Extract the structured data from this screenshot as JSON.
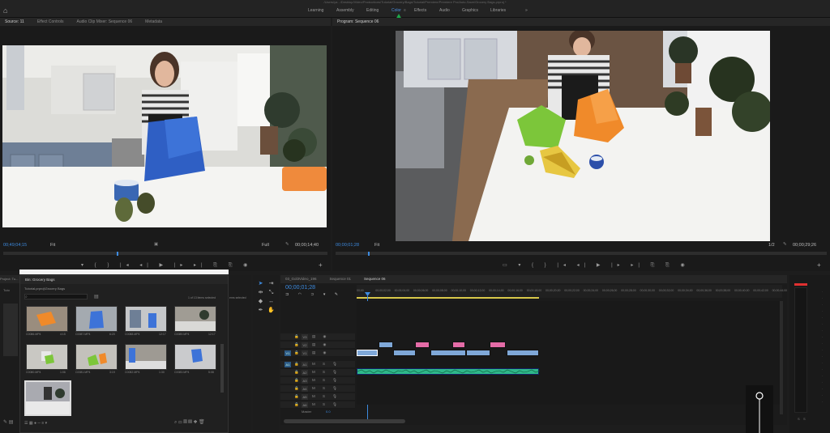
{
  "app": {
    "title_path": "/Users/ya.../Desktop/Video/Productions/Tutorial/Grocery/Bags/Tutorial/Premiere/Premiere Pro/Auto-Save/Grocery Bags.prproj *",
    "workspaces": [
      "Learning",
      "Assembly",
      "Editing",
      "Color",
      "Effects",
      "Audio",
      "Graphics",
      "Libraries"
    ],
    "active_workspace": "Color",
    "workspace_more": "»"
  },
  "source_panel": {
    "tabs": [
      "Source: 11",
      "Effect Controls",
      "Audio Clip Mixer: Sequence 06",
      "Metadata"
    ],
    "timecode": "00;49;04;15",
    "fit": "Fit",
    "quality": "Full",
    "duration": "00;00;14;40"
  },
  "program_panel": {
    "tab": "Program: Sequence 06",
    "timecode": "00;00;01;28",
    "fit": "Fit",
    "quality": "1/2",
    "duration": "00;00;29;26"
  },
  "project_panel": {
    "tab": "Project: Tu...",
    "bin_tab": "Bin: Grocery Bags",
    "path": "Tutorial.prproj\\Grocery Bags",
    "items_selected": "1 of 13 items selected",
    "items_selected_2": "ems selected",
    "thumb_labels": [
      [
        "C0086.MP4",
        "4:15"
      ],
      [
        "C0087.MP4",
        "6:20"
      ],
      [
        "C0088.MP4",
        "12:17"
      ],
      [
        "C0089.MP4",
        "12:17"
      ],
      [
        "C0080.MP4",
        "1:06"
      ],
      [
        "C0081.MP4",
        "3:19"
      ],
      [
        "C0082.MP4",
        "1:30"
      ],
      [
        "C0083.MP4",
        "5:08"
      ],
      [
        "C0084.MP4",
        "10:15"
      ]
    ]
  },
  "timeline": {
    "tabs": [
      "03_Gol3Video_196",
      "Sequence 01",
      "Sequence 06"
    ],
    "active_tab": "Sequence 06",
    "timecode": "00;00;01;28",
    "ruler": [
      "00;00",
      "00;00;02;00",
      "00;00;04;00",
      "00;00;06;00",
      "00;00;08;00",
      "00;00;10;00",
      "00;00;12;00",
      "00;00;14;00",
      "00;00;16;00",
      "00;00;18;00",
      "00;00;20;00",
      "00;00;22;00",
      "00;00;24;00",
      "00;00;26;00",
      "00;00;28;00",
      "00;00;30;00",
      "00;00;32;00",
      "00;00;34;00",
      "00;00;36;00",
      "00;00;38;00",
      "00;00;40;00",
      "00;00;42;00",
      "00;00;44;00"
    ],
    "track_labels": [
      "V3",
      "V2",
      "V1",
      "A1",
      "A2",
      "A3",
      "A4",
      "A5",
      "A6"
    ],
    "master": "Master",
    "master_val": "0.0",
    "v1": "V1",
    "a1": "A1"
  },
  "colors": {
    "accent_blue": "#3d8be0",
    "clip_blue": "#7fa8d8",
    "clip_pink": "#e46ca7",
    "audio_green": "#2fb88a",
    "arrow_green": "#1ea94a",
    "meter_red": "#e03030"
  },
  "meters": {
    "labels": [
      "S",
      "S"
    ]
  }
}
